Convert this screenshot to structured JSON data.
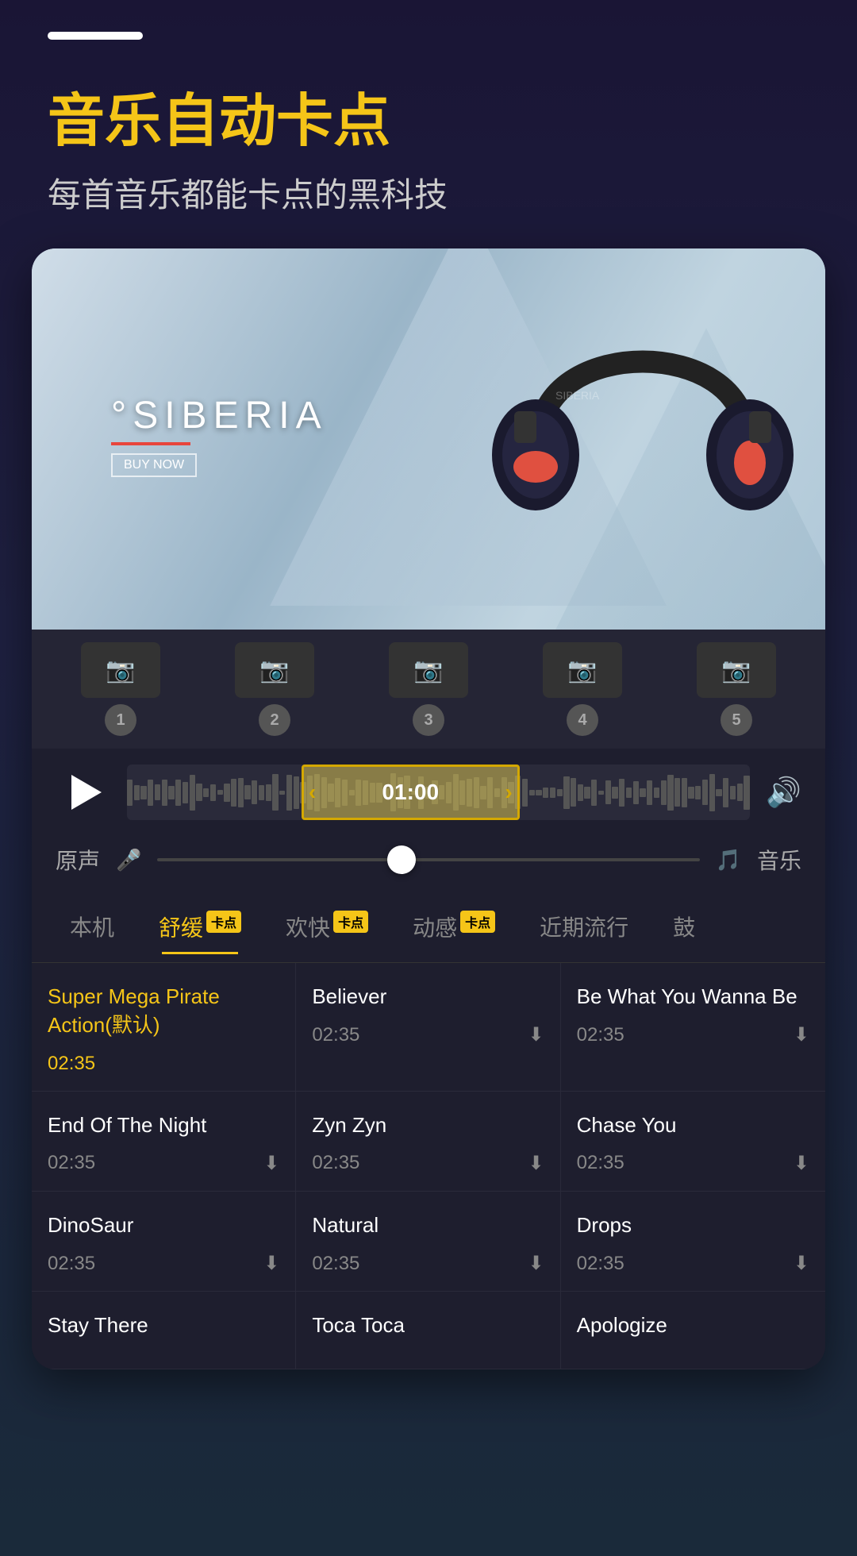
{
  "app": {
    "pill": "",
    "title": "音乐自动卡点",
    "subtitle": "每首音乐都能卡点的黑科技",
    "brand": "°SIBERIA",
    "buy_now": "BUY NOW"
  },
  "thumbnails": [
    {
      "number": "1"
    },
    {
      "number": "2"
    },
    {
      "number": "3"
    },
    {
      "number": "4"
    },
    {
      "number": "5"
    }
  ],
  "player": {
    "time": "01:00",
    "play_label": "play",
    "volume_label": "volume"
  },
  "slider": {
    "left_label": "原声",
    "right_label": "音乐"
  },
  "tabs": [
    {
      "label": "本机",
      "active": false,
      "badge": null
    },
    {
      "label": "舒缓",
      "active": true,
      "badge": "卡点"
    },
    {
      "label": "欢快",
      "active": false,
      "badge": "卡点"
    },
    {
      "label": "动感",
      "active": false,
      "badge": "卡点"
    },
    {
      "label": "近期流行",
      "active": false,
      "badge": null
    },
    {
      "label": "鼓",
      "active": false,
      "badge": null
    }
  ],
  "music_list": [
    {
      "title": "Super Mega Pirate Action(默认)",
      "time": "02:35",
      "download": false,
      "highlighted": true
    },
    {
      "title": "Believer",
      "time": "02:35",
      "download": true,
      "highlighted": false
    },
    {
      "title": "Be What You Wanna Be",
      "time": "02:35",
      "download": true,
      "highlighted": false
    },
    {
      "title": "End Of The Night",
      "time": "02:35",
      "download": true,
      "highlighted": false
    },
    {
      "title": "Zyn Zyn",
      "time": "02:35",
      "download": true,
      "highlighted": false
    },
    {
      "title": "Chase You",
      "time": "02:35",
      "download": true,
      "highlighted": false
    },
    {
      "title": "DinoSaur",
      "time": "02:35",
      "download": true,
      "highlighted": false
    },
    {
      "title": "Natural",
      "time": "02:35",
      "download": true,
      "highlighted": false
    },
    {
      "title": "Drops",
      "time": "02:35",
      "download": true,
      "highlighted": false
    },
    {
      "title": "Stay There",
      "time": "",
      "download": false,
      "highlighted": false
    },
    {
      "title": "Toca Toca",
      "time": "",
      "download": false,
      "highlighted": false
    },
    {
      "title": "Apologize",
      "time": "",
      "download": false,
      "highlighted": false
    }
  ]
}
